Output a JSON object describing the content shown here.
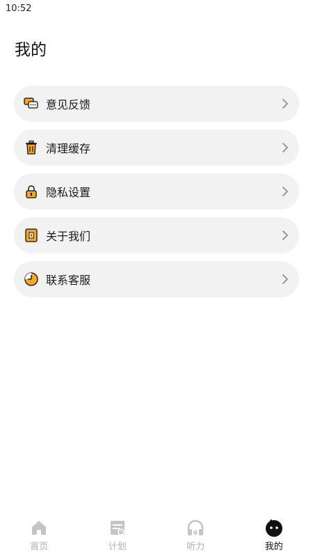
{
  "status_bar": {
    "time": "10:52"
  },
  "page": {
    "title": "我的"
  },
  "menu": [
    {
      "label": "意见反馈",
      "icon": "feedback-icon"
    },
    {
      "label": "清理缓存",
      "icon": "trash-icon"
    },
    {
      "label": "隐私设置",
      "icon": "lock-icon"
    },
    {
      "label": "关于我们",
      "icon": "info-icon"
    },
    {
      "label": "联系客服",
      "icon": "clock-support-icon"
    }
  ],
  "tabbar": {
    "items": [
      {
        "label": "首页",
        "icon": "home-icon",
        "active": false
      },
      {
        "label": "计划",
        "icon": "plan-icon",
        "active": false
      },
      {
        "label": "听力",
        "icon": "headphones-icon",
        "active": false
      },
      {
        "label": "我的",
        "icon": "profile-face-icon",
        "active": true
      }
    ]
  },
  "colors": {
    "accent": "#f5a623",
    "item_bg": "#f2f2f2",
    "inactive": "#b0b0b0",
    "active": "#111111"
  }
}
